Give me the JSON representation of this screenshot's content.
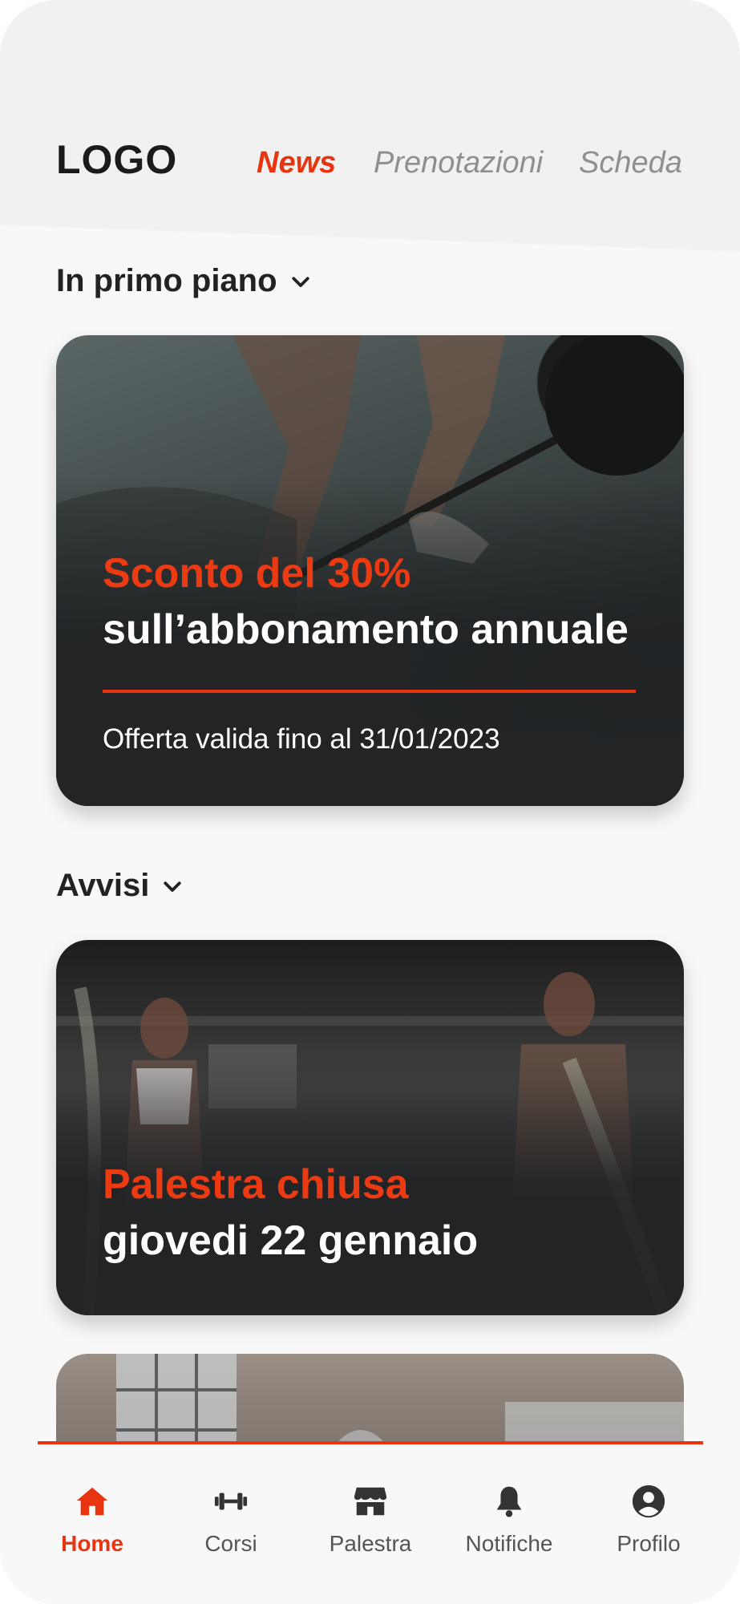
{
  "header": {
    "logo": "LOGO",
    "tabs": [
      {
        "label": "News",
        "active": true
      },
      {
        "label": "Prenotazioni",
        "active": false
      },
      {
        "label": "Scheda",
        "active": false
      }
    ]
  },
  "sections": {
    "featured": {
      "title": "In primo piano",
      "card": {
        "accent": "Sconto del 30%",
        "headline": "sull’abbonamento annuale",
        "note": "Offerta valida fino al 31/01/2023"
      }
    },
    "notices": {
      "title": "Avvisi",
      "card": {
        "accent": "Palestra chiusa",
        "headline": "giovedi 22 gennaio"
      }
    }
  },
  "bottom_nav": [
    {
      "label": "Home",
      "icon": "home-icon",
      "active": true
    },
    {
      "label": "Corsi",
      "icon": "dumbbell-icon",
      "active": false
    },
    {
      "label": "Palestra",
      "icon": "store-icon",
      "active": false
    },
    {
      "label": "Notifiche",
      "icon": "bell-icon",
      "active": false
    },
    {
      "label": "Profilo",
      "icon": "user-circle-icon",
      "active": false
    }
  ],
  "colors": {
    "accent": "#e8340f",
    "text_dark": "#222222",
    "tab_inactive": "#8f8f8f"
  }
}
